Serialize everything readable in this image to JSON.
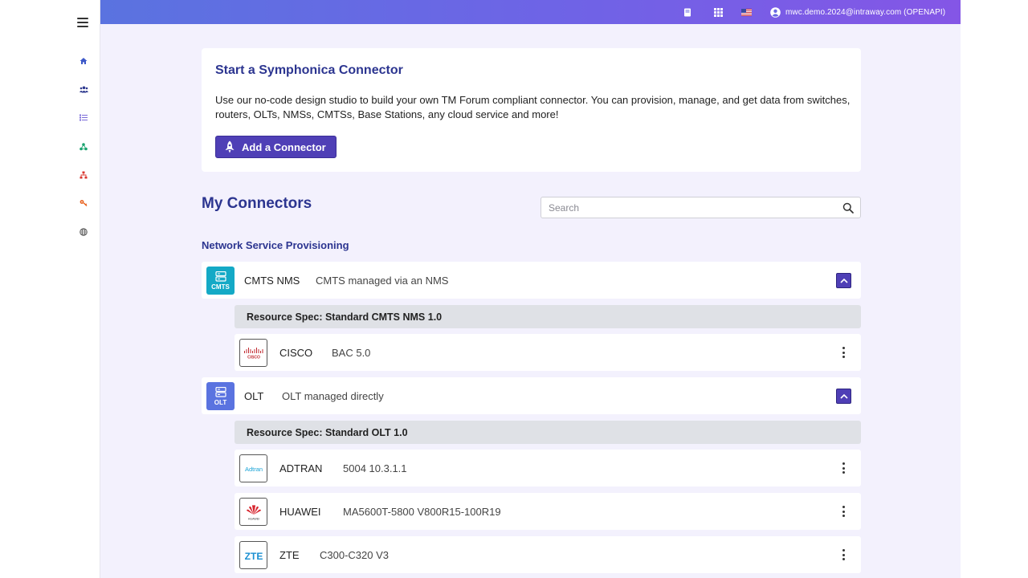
{
  "topbar": {
    "user_label": "mwc.demo.2024@intraway.com (OPENAPI)",
    "icons": [
      "book-icon",
      "apps-grid-icon",
      "us-flag-icon",
      "user-account-icon"
    ],
    "gradient": [
      "#5a73e0",
      "#8456e6"
    ]
  },
  "sidebar": {
    "icons": [
      "home-icon",
      "users-icon",
      "list-icon",
      "network-icon",
      "hierarchy-icon",
      "key-icon",
      "globe-icon"
    ]
  },
  "intro": {
    "title": "Start a Symphonica Connector",
    "description": "Use our no-code design studio to build your own TM Forum compliant connector. You can provision, manage, and get data from switches, routers, OLTs, NMSs, CMTSs, Base Stations, any cloud service and more!",
    "button_label": "Add a Connector"
  },
  "connectors": {
    "title": "My Connectors",
    "search_placeholder": "Search",
    "category": "Network Service Provisioning",
    "groups": [
      {
        "badge": "CMTS",
        "badge_color": "#14a9c6",
        "name": "CMTS NMS",
        "description": "CMTS managed via an NMS",
        "spec": "Resource Spec: Standard CMTS NMS 1.0",
        "vendors": [
          {
            "name": "CISCO",
            "version": "BAC 5.0",
            "logo": "cisco-logo"
          }
        ]
      },
      {
        "badge": "OLT",
        "badge_color": "#5a73e0",
        "name": "OLT",
        "description": "OLT managed directly",
        "spec": "Resource Spec: Standard OLT 1.0",
        "vendors": [
          {
            "name": "ADTRAN",
            "version": "5004 10.3.1.1",
            "logo": "adtran-logo",
            "logo_text": "Adtran"
          },
          {
            "name": "HUAWEI",
            "version": "MA5600T-5800 V800R15-100R19",
            "logo": "huawei-logo",
            "logo_text": "HUAWEI"
          },
          {
            "name": "ZTE",
            "version": "C300-C320 V3",
            "logo": "zte-logo",
            "logo_text": "ZTE"
          }
        ]
      }
    ]
  },
  "accent_color": "#4f3fb6"
}
